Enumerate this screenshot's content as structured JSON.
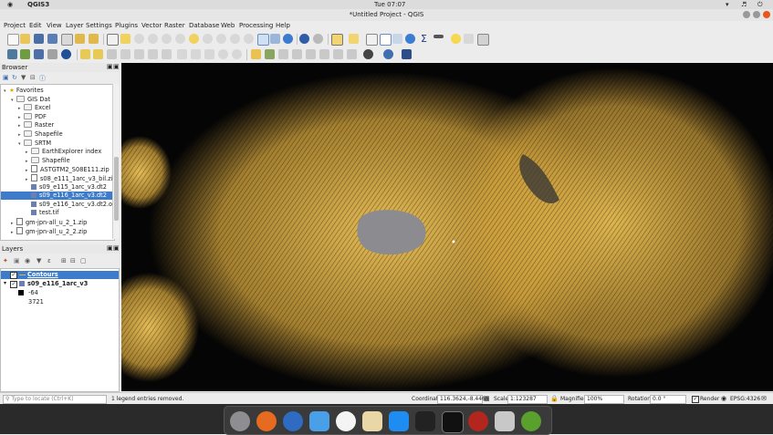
{
  "system_bar": {
    "clock": "Tue 07:07",
    "app_name": "QGIS3"
  },
  "window": {
    "title": "*Untitled Project - QGIS"
  },
  "menu": [
    "Project",
    "Edit",
    "View",
    "Layer",
    "Settings",
    "Plugins",
    "Vector",
    "Raster",
    "Database",
    "Web",
    "Processing",
    "Help"
  ],
  "browser": {
    "title": "Browser",
    "items": [
      {
        "label": "Favorites",
        "indent": 0,
        "icon": "star-icon",
        "arrow": "▾"
      },
      {
        "label": "GIS Dat",
        "indent": 1,
        "icon": "folder-icon",
        "arrow": "▾"
      },
      {
        "label": "Excel",
        "indent": 2,
        "icon": "folder-icon",
        "arrow": "▸"
      },
      {
        "label": "PDF",
        "indent": 2,
        "icon": "folder-icon",
        "arrow": "▸"
      },
      {
        "label": "Raster",
        "indent": 2,
        "icon": "folder-icon",
        "arrow": "▸"
      },
      {
        "label": "Shapefile",
        "indent": 2,
        "icon": "folder-icon",
        "arrow": "▸"
      },
      {
        "label": "SRTM",
        "indent": 2,
        "icon": "folder-icon",
        "arrow": "▾"
      },
      {
        "label": "EarthExplorer index",
        "indent": 3,
        "icon": "folder-icon",
        "arrow": "▸"
      },
      {
        "label": "Shapefile",
        "indent": 3,
        "icon": "folder-icon",
        "arrow": "▸"
      },
      {
        "label": "ASTGTM2_S08E111.zip",
        "indent": 3,
        "icon": "zip-icon",
        "arrow": "▸"
      },
      {
        "label": "s08_e111_1arc_v3_bil.zip",
        "indent": 3,
        "icon": "zip-icon",
        "arrow": "▸"
      },
      {
        "label": "s09_e115_1arc_v3.dt2",
        "indent": 3,
        "icon": "raster-icon",
        "arrow": ""
      },
      {
        "label": "s09_e116_1arc_v3.dt2",
        "indent": 3,
        "icon": "raster-icon",
        "arrow": "",
        "selected": true
      },
      {
        "label": "s09_e116_1arc_v3.dt2.ovr",
        "indent": 3,
        "icon": "raster-icon",
        "arrow": ""
      },
      {
        "label": "test.tif",
        "indent": 3,
        "icon": "raster-icon",
        "arrow": ""
      },
      {
        "label": "gm-jpn-all_u_2_1.zip",
        "indent": 1,
        "icon": "zip-icon",
        "arrow": "▸"
      },
      {
        "label": "gm-jpn-all_u_2_2.zip",
        "indent": 1,
        "icon": "zip-icon",
        "arrow": "▸"
      }
    ]
  },
  "layers": {
    "title": "Layers",
    "contours_label": "Contours",
    "raster_label": "s09_e116_1arc_v3",
    "legend_min": "-64",
    "legend_max": "3721"
  },
  "status": {
    "locate_placeholder": "Type to locate (Ctrl+K)",
    "message": "1 legend entries removed.",
    "coordinate_label": "Coordinate",
    "coordinate_value": "116.3624,-8.4465",
    "scale_label": "Scale",
    "scale_value": "1:123287",
    "magnifier_label": "Magnifier",
    "magnifier_value": "100%",
    "rotation_label": "Rotation",
    "rotation_value": "0.0 °",
    "render_label": "Render",
    "crs_label": "EPSG:4326"
  },
  "colors": {
    "contour": "#e3b341",
    "map_bg": "#050505",
    "selection": "#3d7ccb"
  },
  "dock_icons": [
    "launchpad-icon",
    "firefox-icon",
    "thunderbird-icon",
    "finder-icon",
    "itunes-icon",
    "preview-icon",
    "appstore-icon",
    "dice-icon",
    "terminal-icon",
    "photo-booth-icon",
    "image-capture-icon",
    "qgis-icon"
  ]
}
